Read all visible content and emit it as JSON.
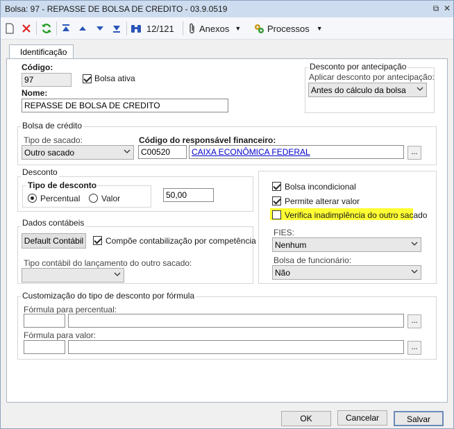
{
  "window": {
    "title": "Bolsa: 97 - REPASSE DE BOLSA DE CREDITO - 03.9.0519",
    "restore_glyph": "⧉",
    "close_glyph": "✕"
  },
  "toolbar": {
    "record_position": "12/121",
    "anexos_label": "Anexos",
    "processos_label": "Processos",
    "dropdown_glyph": "▼"
  },
  "tabs": [
    {
      "label": "Identificação"
    }
  ],
  "form": {
    "codigo_label": "Código:",
    "codigo_value": "97",
    "bolsa_ativa_label": "Bolsa ativa",
    "bolsa_ativa_checked": true,
    "nome_label": "Nome:",
    "nome_value": "REPASSE DE BOLSA DE CREDITO"
  },
  "desconto_antecipacao": {
    "group_title": "Desconto por antecipação",
    "aplicar_label": "Aplicar desconto por antecipação:",
    "aplicar_value": "Antes do cálculo da bolsa"
  },
  "bolsa_credito": {
    "group_title": "Bolsa de crédito",
    "tipo_sacado_label": "Tipo de sacado:",
    "tipo_sacado_value": "Outro sacado",
    "codigo_resp_label": "Código do responsável financeiro:",
    "codigo_resp_value": "C00520",
    "resp_nome": "CAIXA ECONÔMICA FEDERAL",
    "lookup_label": "..."
  },
  "desconto": {
    "group_title": "Desconto",
    "tipo_label": "Tipo de desconto",
    "options": [
      {
        "label": "Percentual",
        "selected": true
      },
      {
        "label": "Valor",
        "selected": false
      }
    ],
    "value": "50,00"
  },
  "flags": {
    "bolsa_incondicional_label": "Bolsa incondicional",
    "bolsa_incondicional_checked": true,
    "permite_alterar_label": "Permite alterar valor",
    "permite_alterar_checked": true,
    "verifica_inadimplencia_label": "Verifica inadimplência do outro sacado",
    "verifica_inadimplencia_checked": false,
    "fies_label": "FIES:",
    "fies_value": "Nenhum",
    "bolsa_func_label": "Bolsa de funcionário:",
    "bolsa_func_value": "Não"
  },
  "dados_contabeis": {
    "group_title": "Dados contábeis",
    "default_button": "Default Contábil",
    "compoe_label": "Compõe contabilização por competência",
    "compoe_checked": true,
    "tipo_contabil_label": "Tipo contábil do lançamento do outro sacado:",
    "tipo_contabil_value": ""
  },
  "customizacao": {
    "group_title": "Customização do tipo de desconto por fórmula",
    "percentual_label": "Fórmula para percentual:",
    "valor_label": "Fórmula para valor:",
    "lookup_label": "..."
  },
  "footer": {
    "ok_label": "OK",
    "cancel_label": "Cancelar",
    "save_label": "Salvar"
  },
  "colors": {
    "titlebar": "#cddcee",
    "highlight": "#ffff33",
    "link": "#0000cc"
  }
}
